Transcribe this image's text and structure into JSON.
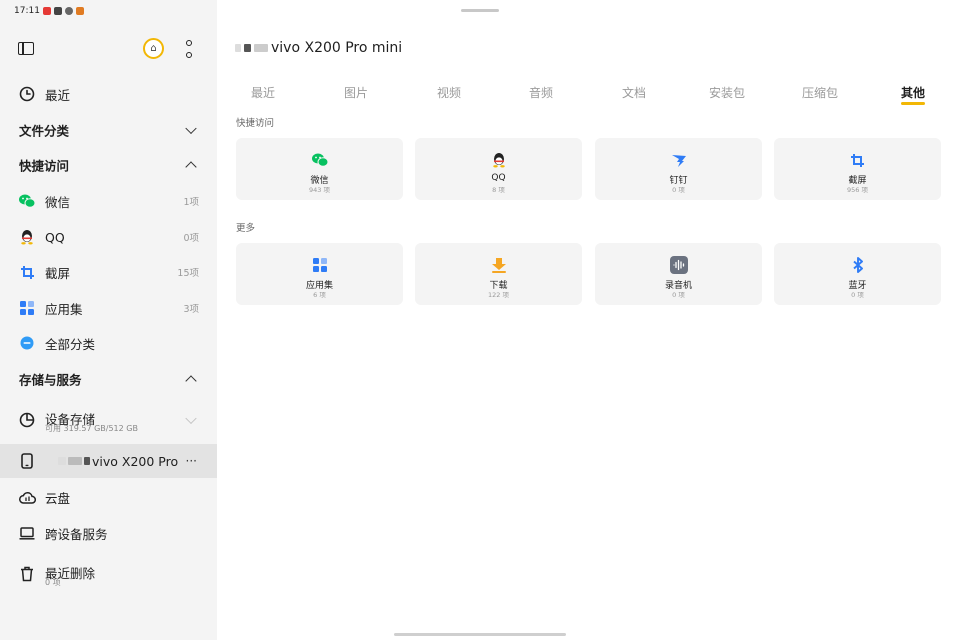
{
  "status_bar": {
    "time": "17:11"
  },
  "sidebar": {
    "recent": {
      "label": "最近"
    },
    "file_categories": {
      "title": "文件分类"
    },
    "quick_access": {
      "title": "快捷访问",
      "items": [
        {
          "label": "微信",
          "count": "1项",
          "icon": "wechat-icon"
        },
        {
          "label": "QQ",
          "count": "0项",
          "icon": "qq-icon"
        },
        {
          "label": "截屏",
          "count": "15项",
          "icon": "crop-icon"
        },
        {
          "label": "应用集",
          "count": "3项",
          "icon": "apps-icon"
        },
        {
          "label": "全部分类",
          "count": "",
          "icon": "more-circle-icon"
        }
      ]
    },
    "storage": {
      "title": "存储与服务",
      "device_storage": {
        "label": "设备存储",
        "sub": "可用 319.57 GB/512 GB"
      },
      "device": {
        "label": "vivo X200 Pro",
        "more": "···"
      },
      "cloud": {
        "label": "云盘"
      },
      "cross_device": {
        "label": "跨设备服务"
      },
      "recently_deleted": {
        "label": "最近删除",
        "sub": "0 项"
      }
    }
  },
  "main": {
    "device_title": "vivo X200 Pro mini",
    "tabs": [
      "最近",
      "图片",
      "视频",
      "音频",
      "文档",
      "安装包",
      "压缩包",
      "其他"
    ],
    "active_tab": "其他",
    "quick_access_label": "快捷访问",
    "quick_cards": [
      {
        "label": "微信",
        "count": "943 项",
        "icon": "wechat-icon"
      },
      {
        "label": "QQ",
        "count": "8 项",
        "icon": "qq-icon"
      },
      {
        "label": "钉钉",
        "count": "0 项",
        "icon": "dingtalk-icon"
      },
      {
        "label": "截屏",
        "count": "956 项",
        "icon": "crop-icon"
      }
    ],
    "more_label": "更多",
    "more_cards": [
      {
        "label": "应用集",
        "count": "6 项",
        "icon": "apps-icon"
      },
      {
        "label": "下载",
        "count": "122 项",
        "icon": "download-icon"
      },
      {
        "label": "录音机",
        "count": "0 项",
        "icon": "recorder-icon"
      },
      {
        "label": "蓝牙",
        "count": "0 项",
        "icon": "bluetooth-icon"
      }
    ]
  },
  "colors": {
    "accent": "#f2b705",
    "wechat": "#07c160",
    "blue": "#2f7cf6"
  }
}
